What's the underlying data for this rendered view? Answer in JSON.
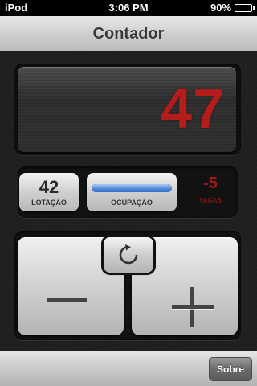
{
  "status_bar": {
    "carrier": "iPod",
    "time": "3:06 PM",
    "battery_percent": "90%",
    "battery_level": 0.9
  },
  "nav": {
    "title": "Contador"
  },
  "display": {
    "count": "47",
    "color": "#b51c1c"
  },
  "stats": {
    "lotacao_value": "42",
    "lotacao_label": "LOTAÇÃO",
    "ocupacao_label": "OCUPAÇÃO",
    "ocupacao_level": 1.0,
    "vagas_value": "-5",
    "vagas_label": "VAGAS",
    "accent": "#4f85d6"
  },
  "buttons": {
    "minus_icon": "minus-icon",
    "plus_icon": "plus-icon",
    "reset_icon": "refresh-icon"
  },
  "toolbar": {
    "sobre_label": "Sobre"
  }
}
